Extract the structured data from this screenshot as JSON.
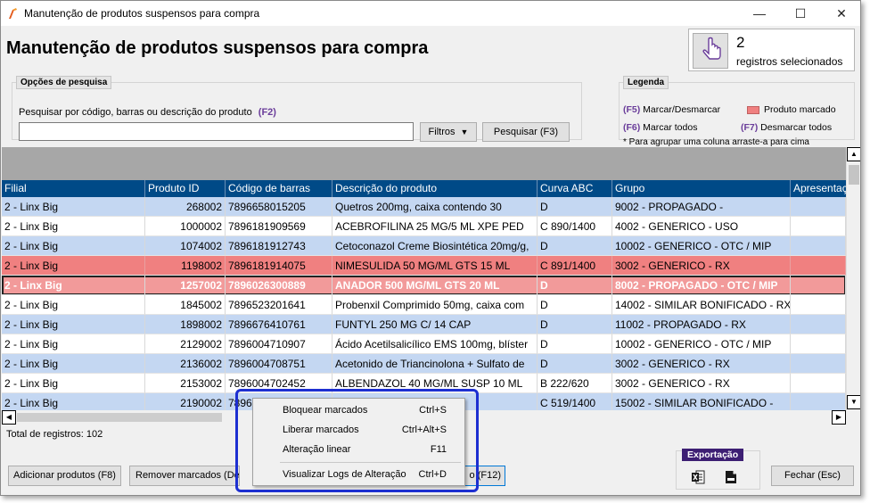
{
  "window": {
    "title": "Manutenção de produtos suspensos para compra",
    "minimize": "—",
    "maximize": "☐",
    "close": "✕"
  },
  "page": {
    "heading": "Manutenção de produtos suspensos para compra"
  },
  "selection": {
    "count": "2",
    "label": "registros selecionados"
  },
  "search": {
    "legend": "Opções de pesquisa",
    "label": "Pesquisar por código, barras ou descrição do produto",
    "shortcut": "(F2)",
    "value": "",
    "filters_label": "Filtros",
    "search_button": "Pesquisar (F3)"
  },
  "legenda": {
    "title": "Legenda",
    "f5_key": "(F5)",
    "f5_label": "Marcar/Desmarcar",
    "marked_label": "Produto marcado",
    "f6_key": "(F6)",
    "f6_label": "Marcar todos",
    "f7_key": "(F7)",
    "f7_label": "Desmarcar todos",
    "note": "* Para agrupar uma coluna arraste-a para cima"
  },
  "grid": {
    "columns": [
      "Filial",
      "Produto ID",
      "Código de barras",
      "Descrição do produto",
      "Curva ABC",
      "Grupo",
      "Apresentaç"
    ],
    "rows": [
      {
        "filial": "2 - Linx Big",
        "id": "268002",
        "barras": "7896658015205",
        "descricao": "Quetros 200mg, caixa contendo 30",
        "curva": "D",
        "grupo": "9002 - PROPAGADO -",
        "apres": ""
      },
      {
        "filial": "2 - Linx Big",
        "id": "1000002",
        "barras": "7896181909569",
        "descricao": "ACEBROFILINA 25 MG/5 ML XPE PED",
        "curva": "C 890/1400",
        "grupo": "4002 - GENERICO - USO",
        "apres": ""
      },
      {
        "filial": "2 - Linx Big",
        "id": "1074002",
        "barras": "7896181912743",
        "descricao": "Cetoconazol Creme Biosintética 20mg/g,",
        "curva": "D",
        "grupo": "10002 - GENERICO - OTC / MIP",
        "apres": ""
      },
      {
        "filial": "2 - Linx Big",
        "id": "1198002",
        "barras": "7896181914075",
        "descricao": "NIMESULIDA 50 MG/ML GTS 15 ML",
        "curva": "C 891/1400",
        "grupo": "3002 - GENERICO - RX",
        "apres": ""
      },
      {
        "filial": "2 - Linx Big",
        "id": "1257002",
        "barras": "7896026300889",
        "descricao": "ANADOR 500 MG/ML GTS 20 ML",
        "curva": "D",
        "grupo": "8002 - PROPAGADO - OTC / MIP",
        "apres": ""
      },
      {
        "filial": "2 - Linx Big",
        "id": "1845002",
        "barras": "7896523201641",
        "descricao": "Probenxil Comprimido 50mg, caixa com",
        "curva": "D",
        "grupo": "14002 - SIMILAR BONIFICADO - RX",
        "apres": ""
      },
      {
        "filial": "2 - Linx Big",
        "id": "1898002",
        "barras": "7896676410761",
        "descricao": "FUNTYL 250 MG C/ 14 CAP",
        "curva": "D",
        "grupo": "11002 - PROPAGADO - RX",
        "apres": ""
      },
      {
        "filial": "2 - Linx Big",
        "id": "2129002",
        "barras": "7896004710907",
        "descricao": "Ácido Acetilsalicílico EMS 100mg, blíster",
        "curva": "D",
        "grupo": "10002 - GENERICO - OTC / MIP",
        "apres": ""
      },
      {
        "filial": "2 - Linx Big",
        "id": "2136002",
        "barras": "7896004708751",
        "descricao": "Acetonido de Triancinolona + Sulfato de",
        "curva": "D",
        "grupo": "3002 - GENERICO - RX",
        "apres": ""
      },
      {
        "filial": "2 - Linx Big",
        "id": "2153002",
        "barras": "7896004702452",
        "descricao": "ALBENDAZOL 40 MG/ML SUSP 10 ML",
        "curva": "B 222/620",
        "grupo": "3002 - GENERICO - RX",
        "apres": ""
      },
      {
        "filial": "2 - Linx Big",
        "id": "2190002",
        "barras": "7896",
        "descricao": "",
        "curva": "C 519/1400",
        "grupo": "15002 - SIMILAR BONIFICADO -",
        "apres": ""
      }
    ]
  },
  "footer": {
    "total_label": "Total de registros: 102",
    "add_button": "Adicionar produtos (F8)",
    "remove_button": "Remover marcados (De",
    "hidden_button_tail": "o (F12)",
    "export_title": "Exportação",
    "close_button": "Fechar (Esc)"
  },
  "context_menu": {
    "items": [
      {
        "label": "Bloquear marcados",
        "key": "Ctrl+S"
      },
      {
        "label": "Liberar marcados",
        "key": "Ctrl+Alt+S"
      },
      {
        "label": "Alteração linear",
        "key": "F11"
      },
      {
        "label": "Visualizar Logs de Alteração",
        "key": "Ctrl+D"
      }
    ]
  },
  "colors": {
    "header_bg": "#004a87",
    "row_blue": "#c4d7f2",
    "row_white": "#ffffff",
    "row_marked": "#f08080",
    "row_selected_marked": "#f29a9a",
    "accent_purple": "#6a3d9a",
    "focus_ring": "#1d2fd1"
  }
}
